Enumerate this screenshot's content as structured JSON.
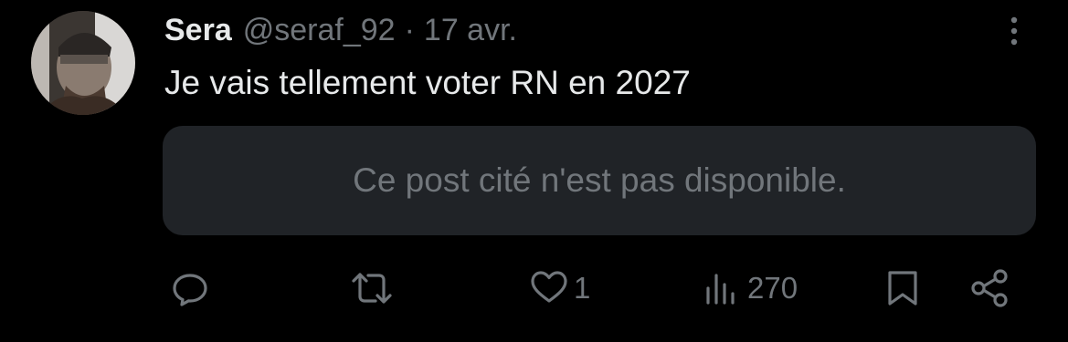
{
  "tweet": {
    "author_name": "Sera",
    "handle": "@seraf_92",
    "separator": "·",
    "date": "17 avr.",
    "text": "Je vais tellement voter RN en 2027"
  },
  "quote": {
    "unavailable_text": "Ce post cité n'est pas disponible."
  },
  "actions": {
    "reply_icon": "reply-icon",
    "retweet_icon": "retweet-icon",
    "like_icon": "heart-icon",
    "like_count": "1",
    "views_icon": "views-icon",
    "views_count": "270",
    "bookmark_icon": "bookmark-icon",
    "share_icon": "share-icon"
  },
  "more_icon": "more-vertical-icon",
  "colors": {
    "background": "#000000",
    "primary_text": "#e7e9ea",
    "secondary_text": "#71767b",
    "quote_background": "#202327"
  }
}
